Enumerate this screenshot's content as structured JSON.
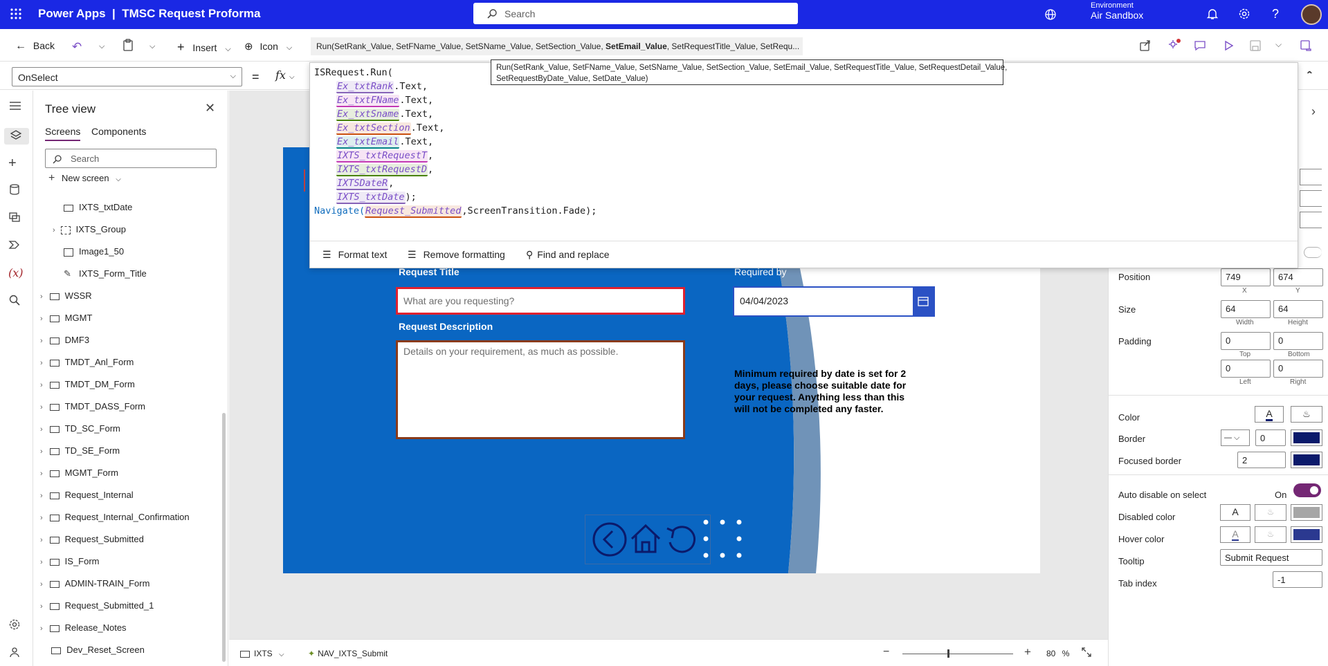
{
  "app": {
    "title": "Power Apps  |  TMSC Request Proforma",
    "search_placeholder": "Search",
    "environment_label": "Environment",
    "environment_name": "Air Sandbox"
  },
  "toolbar": {
    "back": "Back",
    "insert": "Insert",
    "icon": "Icon",
    "formula_preview_a": "Run(SetRank_Value, SetFName_Value, SetSName_Value, SetSection_Value, ",
    "formula_preview_bold": "SetEmail_Value",
    "formula_preview_b": ", SetRequestTitle_Value, SetRequ..."
  },
  "property_bar": {
    "property": "OnSelect",
    "equals": "=",
    "fx": "fx"
  },
  "formula": {
    "tooltip_line1": "Run(SetRank_Value, SetFName_Value, SetSName_Value, SetSection_Value, SetEmail_Value, SetRequestTitle_Value, SetRequestDetail_Value,",
    "tooltip_line2": "SetRequestByDate_Value, SetDate_Value)",
    "line1": "ISRequest.Run(",
    "args": [
      {
        "name": "Ex_txtRank",
        "suffix": ".Text,"
      },
      {
        "name": "Ex_txtFName",
        "suffix": ".Text,"
      },
      {
        "name": "Ex_txtSname",
        "suffix": ".Text,"
      },
      {
        "name": "Ex_txtSection",
        "suffix": ".Text,"
      },
      {
        "name": "Ex_txtEmail",
        "suffix": ".Text,"
      },
      {
        "name": "IXTS_txtRequestT",
        "suffix": ","
      },
      {
        "name": "IXTS_txtRequestD",
        "suffix": ","
      },
      {
        "name": "IXTSDateR",
        "suffix": ","
      },
      {
        "name": "IXTS_txtDate",
        "suffix": ");"
      }
    ],
    "nav_fn": "Navigate(",
    "nav_target": "Request_Submitted",
    "nav_rest": ",ScreenTransition.Fade);",
    "actions": {
      "format_text": "Format text",
      "remove_formatting": "Remove formatting",
      "find_replace": "Find and replace"
    }
  },
  "tree": {
    "title": "Tree view",
    "tabs": [
      "Screens",
      "Components"
    ],
    "search_placeholder": "Search",
    "new_screen": "New screen",
    "children": [
      "IXTS_txtDate",
      "IXTS_Group",
      "Image1_50",
      "IXTS_Form_Title"
    ],
    "screens": [
      "WSSR",
      "MGMT",
      "DMF3",
      "TMDT_Anl_Form",
      "TMDT_DM_Form",
      "TMDT_DASS_Form",
      "TD_SC_Form",
      "TD_SE_Form",
      "MGMT_Form",
      "Request_Internal",
      "Request_Internal_Confirmation",
      "Request_Submitted",
      "IS_Form",
      "ADMIN-TRAIN_Form",
      "Request_Submitted_1",
      "Release_Notes",
      "Dev_Reset_Screen"
    ]
  },
  "form": {
    "request_title_label": "Request Title",
    "request_title_placeholder": "What are you requesting?",
    "required_by_label": "Required by",
    "required_by_value": "04/04/2023",
    "request_desc_label": "Request Description",
    "request_desc_placeholder": "Details on your requirement, as much as possible.",
    "note": "Minimum required by date is set for 2 days, please choose suitable date for your request. Anything less than this will not be completed any faster."
  },
  "status": {
    "screen": "IXTS",
    "control": "NAV_IXTS_Submit",
    "zoom": "80",
    "zoom_unit": "%"
  },
  "props": {
    "position_label": "Position",
    "x": "749",
    "y": "674",
    "x_label": "X",
    "y_label": "Y",
    "size_label": "Size",
    "width": "64",
    "height": "64",
    "width_label": "Width",
    "height_label": "Height",
    "padding_label": "Padding",
    "pad_top": "0",
    "pad_bottom": "0",
    "pad_left": "0",
    "pad_right": "0",
    "top_label": "Top",
    "bottom_label": "Bottom",
    "left_label": "Left",
    "right_label": "Right",
    "color_label": "Color",
    "border_label": "Border",
    "border_width": "0",
    "focused_border_label": "Focused border",
    "focused_border_width": "2",
    "auto_disable_label": "Auto disable on select",
    "auto_disable_value": "On",
    "disabled_color_label": "Disabled color",
    "hover_color_label": "Hover color",
    "tooltip_label": "Tooltip",
    "tooltip_value": "Submit Request",
    "tab_index_label": "Tab index",
    "tab_index_value": "-1"
  },
  "colors": {
    "header": "#1a28e4",
    "canvas_blue": "#0a66c2",
    "swatch_dark": "#0b1a6b",
    "hover_swatch": "#2b3990",
    "toggle": "#742774"
  }
}
